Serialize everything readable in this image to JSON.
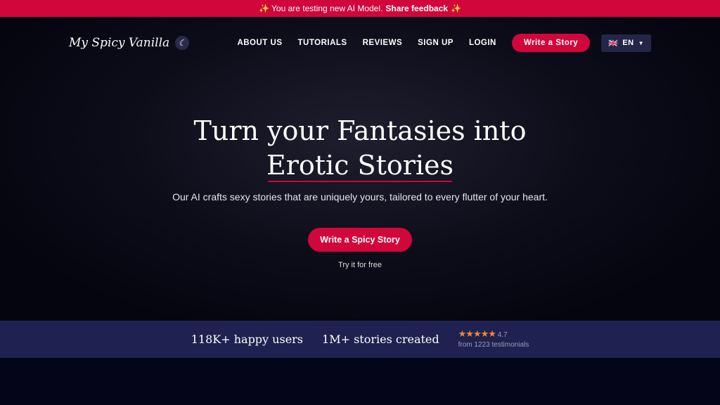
{
  "banner": {
    "text": "✨ You are testing new AI Model.",
    "link": "Share feedback",
    "suffix": "✨"
  },
  "nav": {
    "logo": "My Spicy Vanilla",
    "links": [
      "ABOUT US",
      "TUTORIALS",
      "REVIEWS",
      "SIGN UP",
      "LOGIN"
    ],
    "cta": "Write a Story",
    "lang": "EN",
    "lang_flag": "🇬🇧"
  },
  "hero": {
    "title_line1": "Turn your Fantasies into",
    "title_line2": "Erotic Stories",
    "subtitle": "Our AI crafts sexy stories that are uniquely yours, tailored to every flutter of your heart.",
    "cta": "Write a Spicy Story",
    "note": "Try it for free"
  },
  "stats": {
    "users": "118K+ happy users",
    "stories": "1M+ stories created",
    "stars": "★★★★★",
    "rating": "4.7",
    "rating_value": 4.7,
    "testimonials": "from 1223 testimonials"
  },
  "colors": {
    "accent": "#d1063a",
    "stats_bg": "#1f2150",
    "star": "#f0873a"
  }
}
